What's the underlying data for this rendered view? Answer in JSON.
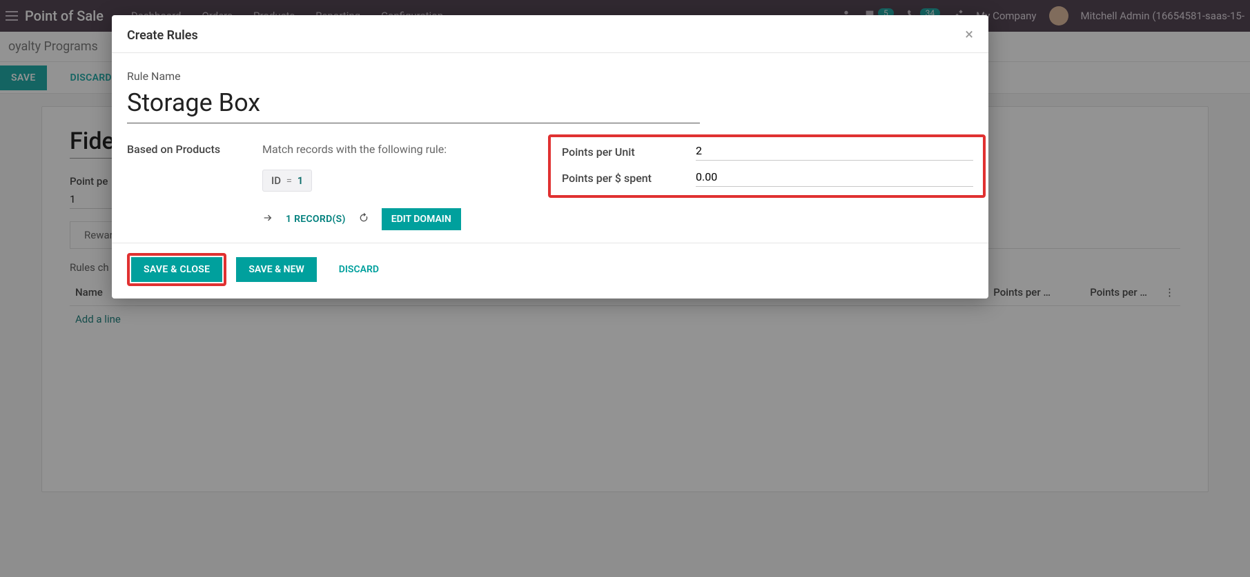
{
  "navbar": {
    "app_title": "Point of Sale",
    "links": [
      "Dashboard",
      "Orders",
      "Products",
      "Reporting",
      "Configuration"
    ],
    "badge_msg": "5",
    "badge_call": "34",
    "company": "My Company",
    "user": "Mitchell Admin (16654581-saas-15-"
  },
  "breadcrumb": {
    "crumb1": "oyalty Programs"
  },
  "actionbar": {
    "save": "SAVE",
    "discard": "DISCARD"
  },
  "background_form": {
    "title": "Fide",
    "point_label": "Point pe",
    "point_value": "1",
    "tab1": "Rewar",
    "rules_label": "Rules ch",
    "col_name": "Name",
    "col_ppu": "Points per …",
    "col_pps": "Points per …",
    "add_line": "Add a line"
  },
  "modal": {
    "title": "Create Rules",
    "rule_name_label": "Rule Name",
    "rule_name_value": "Storage Box",
    "based_on_label": "Based on Products",
    "match_text": "Match records with the following rule:",
    "domain_id_label": "ID",
    "domain_eq": "=",
    "domain_id_value": "1",
    "records_count": "1 RECORD(S)",
    "edit_domain": "EDIT DOMAIN",
    "ppu_label": "Points per Unit",
    "ppu_value": "2",
    "pps_label": "Points per $ spent",
    "pps_value": "0.00",
    "save_close": "SAVE & CLOSE",
    "save_new": "SAVE & NEW",
    "discard": "DISCARD"
  }
}
